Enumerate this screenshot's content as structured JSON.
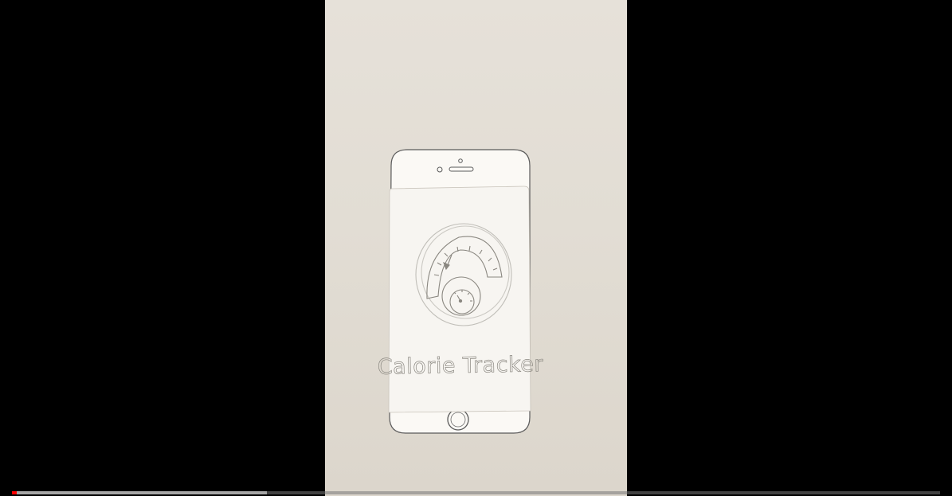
{
  "video": {
    "sketch_title": "Calorie Tracker",
    "progress": {
      "played_fraction": 0.005,
      "buffered_fraction": 0.275,
      "played_color": "#ff0000"
    }
  }
}
